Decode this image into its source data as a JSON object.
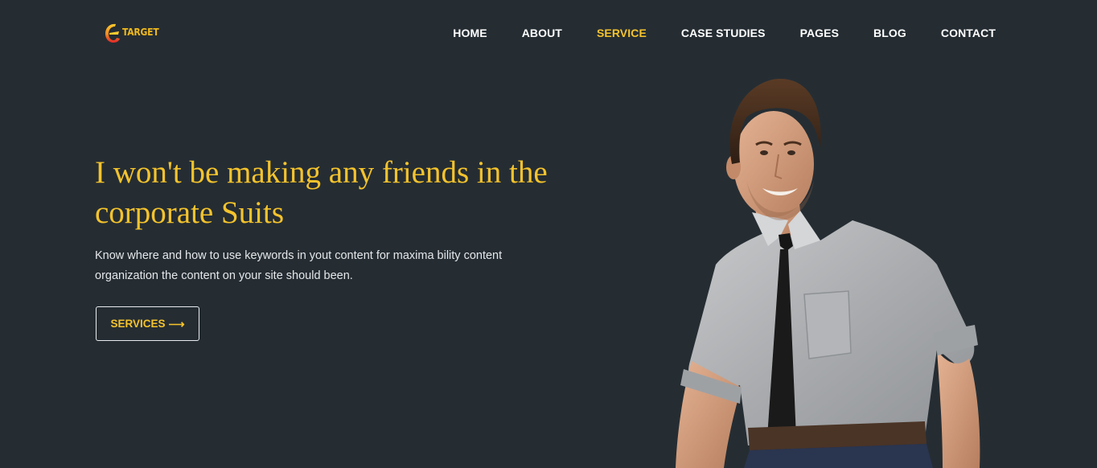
{
  "brand": {
    "name": "TARGET",
    "logo_icon": "target-logo-icon",
    "colors": {
      "primary": "#e8332a",
      "accent": "#f5c32c"
    }
  },
  "nav": {
    "items": [
      {
        "label": "HOME",
        "active": false
      },
      {
        "label": "ABOUT",
        "active": false
      },
      {
        "label": "SERVICE",
        "active": true
      },
      {
        "label": "CASE STUDIES",
        "active": false
      },
      {
        "label": "PAGES",
        "active": false
      },
      {
        "label": "BLOG",
        "active": false
      },
      {
        "label": "CONTACT",
        "active": false
      }
    ]
  },
  "hero": {
    "title": "I won't be making any friends in the corporate Suits",
    "description": "Know where and how to use keywords in yout content for maxima bility content organization the content on your site should been.",
    "button_label": "SERVICES",
    "button_icon": "arrow-right-icon",
    "image_subject": "smiling man in grey shirt and black tie"
  },
  "theme": {
    "background": "#252d33",
    "text": "#ffffff",
    "highlight": "#f5c32c"
  }
}
